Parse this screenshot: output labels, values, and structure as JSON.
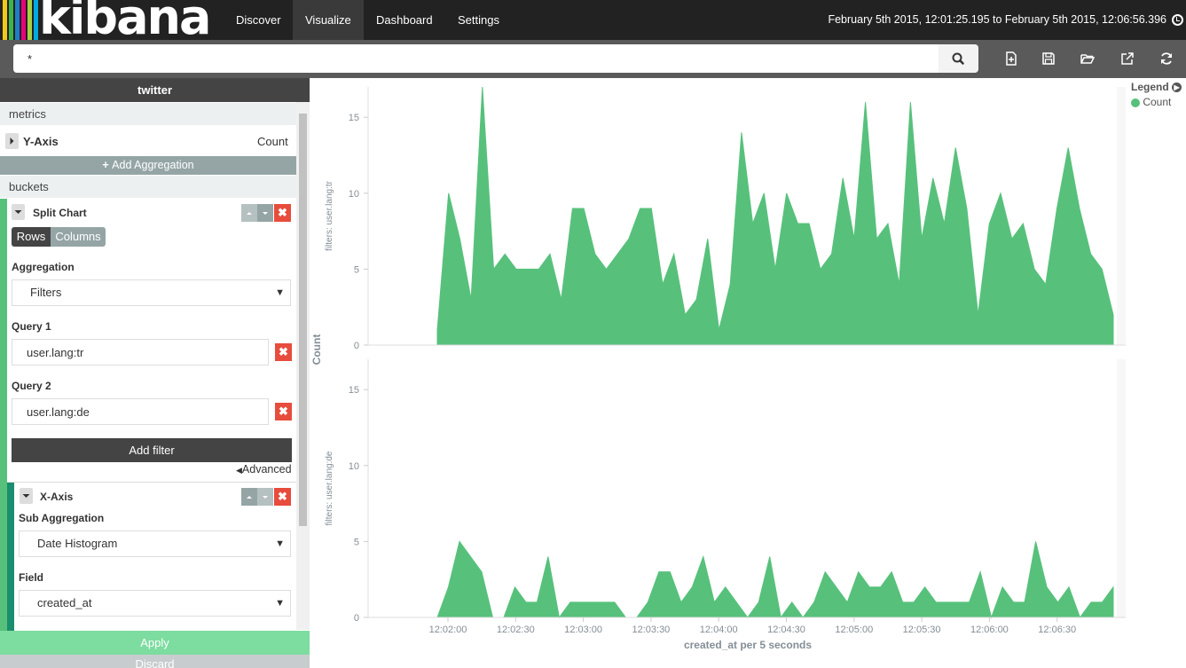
{
  "brand": {
    "name": "kibana",
    "stripe_colors": [
      "#f0c81e",
      "#3cb44b",
      "#1e7dc8",
      "#e6007e",
      "#a8cf45",
      "#00a9e0"
    ]
  },
  "nav": {
    "items": [
      {
        "label": "Discover",
        "active": false
      },
      {
        "label": "Visualize",
        "active": true
      },
      {
        "label": "Dashboard",
        "active": false
      },
      {
        "label": "Settings",
        "active": false
      }
    ]
  },
  "timerange": "February 5th 2015, 12:01:25.195 to February 5th 2015, 12:06:56.396",
  "search": {
    "value": "*"
  },
  "icons": {
    "new": "new-visualization-icon",
    "save": "save-icon",
    "open": "open-folder-icon",
    "share": "share-icon",
    "refresh": "refresh-icon",
    "search": "search-icon",
    "clock": "clock-icon"
  },
  "sidebar": {
    "index": "twitter",
    "metrics_label": "metrics",
    "yaxis": {
      "label": "Y-Axis",
      "value": "Count"
    },
    "add_aggregation": "Add Aggregation",
    "buckets_label": "buckets",
    "split_chart": {
      "label": "Split Chart",
      "rows_label": "Rows",
      "columns_label": "Columns",
      "aggregation_label": "Aggregation",
      "aggregation_value": "Filters",
      "query1_label": "Query 1",
      "query1_value": "user.lang:tr",
      "query2_label": "Query 2",
      "query2_value": "user.lang:de",
      "add_filter": "Add filter",
      "advanced": "Advanced"
    },
    "xaxis": {
      "label": "X-Axis",
      "sub_agg_label": "Sub Aggregation",
      "sub_agg_value": "Date Histogram",
      "field_label": "Field",
      "field_value": "created_at"
    },
    "apply": "Apply",
    "discard": "Discard"
  },
  "chart_data": [
    {
      "type": "area",
      "ylabel": "filters: user.lang:tr",
      "shared_ylabel": "Count",
      "ylim": [
        0,
        17
      ],
      "yticks": [
        0,
        5,
        10,
        15
      ],
      "x_ticks": [
        "12:02:00",
        "12:02:30",
        "12:03:00",
        "12:03:30",
        "12:04:00",
        "12:04:30",
        "12:05:00",
        "12:05:30",
        "12:06:00",
        "12:06:30"
      ],
      "series": [
        {
          "name": "Count",
          "color": "#57c17b",
          "values": [
            1,
            10,
            7,
            3,
            17,
            5,
            6,
            5,
            5,
            5,
            6,
            3,
            9,
            9,
            6,
            5,
            6,
            7,
            9,
            9,
            4,
            6,
            2,
            3,
            7,
            1,
            4,
            14,
            8,
            10,
            5,
            10,
            8,
            8,
            5,
            6,
            11,
            7,
            16,
            7,
            8,
            4,
            16,
            7,
            11,
            8,
            13,
            9,
            2,
            8,
            10,
            7,
            8,
            5,
            4,
            9,
            13,
            9,
            6,
            5,
            2
          ]
        }
      ]
    },
    {
      "type": "area",
      "ylabel": "filters: user.lang:de",
      "xlabel": "created_at per 5 seconds",
      "ylim": [
        0,
        17
      ],
      "yticks": [
        0,
        5,
        10,
        15
      ],
      "x_ticks": [
        "12:02:00",
        "12:02:30",
        "12:03:00",
        "12:03:30",
        "12:04:00",
        "12:04:30",
        "12:05:00",
        "12:05:30",
        "12:06:00",
        "12:06:30"
      ],
      "series": [
        {
          "name": "Count",
          "color": "#57c17b",
          "values": [
            0,
            2,
            5,
            4,
            3,
            0,
            0,
            2,
            1,
            1,
            4,
            0,
            1,
            1,
            1,
            1,
            1,
            0,
            0,
            1,
            3,
            3,
            1,
            2,
            4,
            1,
            2,
            1,
            0,
            1,
            4,
            0,
            1,
            0,
            1,
            3,
            2,
            1,
            3,
            2,
            2,
            3,
            1,
            1,
            2,
            1,
            1,
            1,
            1,
            3,
            0,
            2,
            1,
            1,
            5,
            2,
            1,
            2,
            0,
            1,
            1,
            2
          ]
        }
      ]
    }
  ],
  "legend": {
    "title": "Legend",
    "items": [
      {
        "label": "Count",
        "color": "#57c17b"
      }
    ]
  }
}
